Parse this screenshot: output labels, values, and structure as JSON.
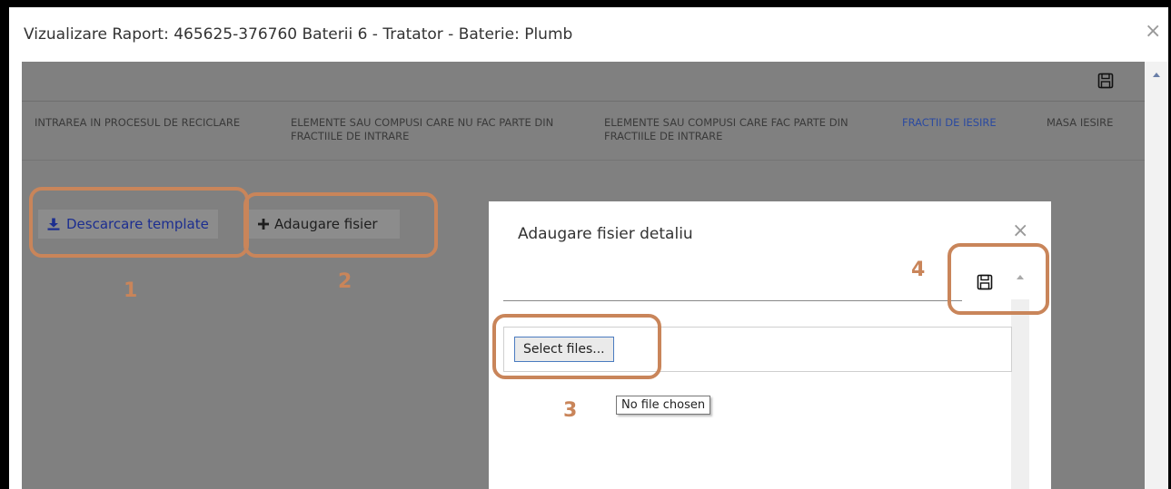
{
  "window": {
    "title": "Vizualizare Raport: 465625-376760 Baterii 6 - Tratator - Baterie: Plumb",
    "close_glyph": "×"
  },
  "tabs": [
    {
      "label": "INTRAREA IN PROCESUL DE RECICLARE",
      "active": false
    },
    {
      "label": "ELEMENTE SAU COMPUSI CARE NU FAC PARTE DIN FRACTIILE DE INTRARE",
      "active": false
    },
    {
      "label": "ELEMENTE SAU COMPUSI CARE FAC PARTE DIN FRACTIILE DE INTRARE",
      "active": false
    },
    {
      "label": "FRACTII DE IESIRE",
      "active": true
    },
    {
      "label": "MASA IESIRE",
      "active": false
    }
  ],
  "actions": {
    "download_label": "Descarcare template",
    "add_label": "Adaugare fisier"
  },
  "annotations": [
    "1",
    "2",
    "3",
    "4"
  ],
  "dialog": {
    "title": "Adaugare fisier detaliu",
    "close_glyph": "×",
    "select_files_label": "Select files...",
    "tooltip": "No file chosen"
  },
  "icons": {
    "toolbar_save": "floppy-disk-icon",
    "dialog_save": "floppy-disk-icon",
    "download": "download-icon",
    "add": "plus-icon"
  },
  "colors": {
    "active_tab": "#2b4aa0",
    "link_blue": "#1c2e90",
    "callout": "#c9855a",
    "overlay_gray": "#808080"
  }
}
